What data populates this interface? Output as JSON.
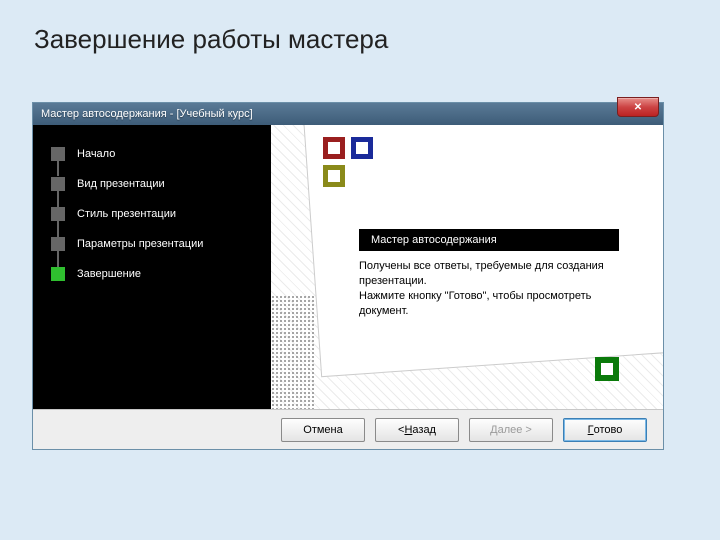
{
  "page_title": "Завершение работы мастера",
  "window": {
    "title": "Мастер автосодержания - [Учебный курс]"
  },
  "steps": [
    {
      "label": "Начало",
      "active": false
    },
    {
      "label": "Вид презентации",
      "active": false
    },
    {
      "label": "Стиль презентации",
      "active": false
    },
    {
      "label": "Параметры презентации",
      "active": false
    },
    {
      "label": "Завершение",
      "active": true
    }
  ],
  "content": {
    "heading": "Мастер автосодержания",
    "text1": "Получены все ответы, требуемые для создания презентации.",
    "text2": "Нажмите кнопку \"Готово\", чтобы просмотреть документ."
  },
  "buttons": {
    "cancel": "Отмена",
    "back_prefix": "< ",
    "back_u": "Н",
    "back_rest": "азад",
    "next_u": "Д",
    "next_rest": "алее >",
    "finish_u": "Г",
    "finish_rest": "отово"
  }
}
